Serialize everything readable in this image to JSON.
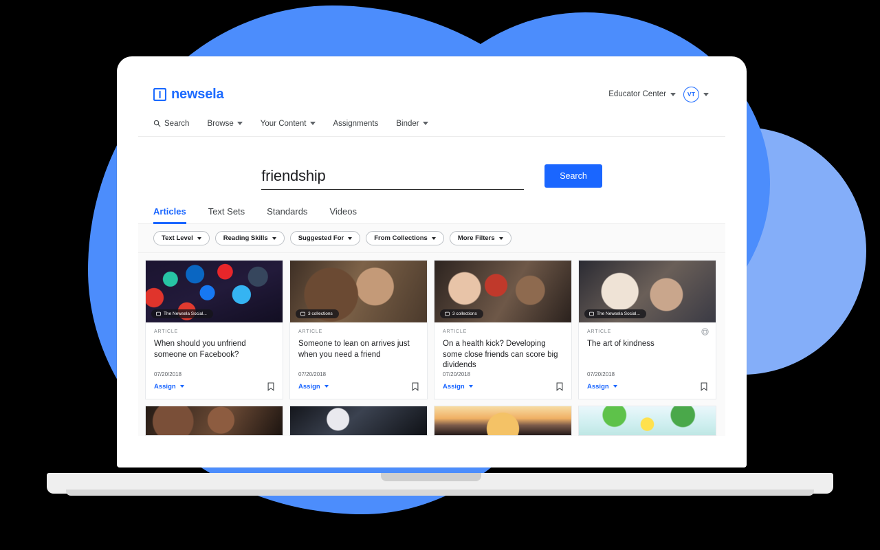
{
  "brand": {
    "name": "newsela",
    "logo_icon": "newsela-book-logo",
    "color": "#1d6bff"
  },
  "topbar": {
    "educator_center": "Educator Center",
    "educator_caret_icon": "chevron-down-icon",
    "avatar_initials": "VT",
    "avatar_caret_icon": "chevron-down-icon"
  },
  "nav": {
    "items": [
      {
        "label": "Search",
        "icon": "search-icon",
        "has_caret": false
      },
      {
        "label": "Browse",
        "icon": "",
        "has_caret": true
      },
      {
        "label": "Your Content",
        "icon": "",
        "has_caret": true
      },
      {
        "label": "Assignments",
        "icon": "",
        "has_caret": false
      },
      {
        "label": "Binder",
        "icon": "",
        "has_caret": true
      }
    ]
  },
  "search": {
    "value": "friendship",
    "placeholder": "Search",
    "button_label": "Search",
    "button_color": "#1a66ff"
  },
  "tabs": [
    {
      "label": "Articles",
      "active": true
    },
    {
      "label": "Text Sets",
      "active": false
    },
    {
      "label": "Standards",
      "active": false
    },
    {
      "label": "Videos",
      "active": false
    }
  ],
  "filters": [
    {
      "label": "Text Level"
    },
    {
      "label": "Reading Skills"
    },
    {
      "label": "Suggested For"
    },
    {
      "label": "From Collections"
    },
    {
      "label": "More Filters"
    }
  ],
  "cards": [
    {
      "kicker": "ARTICLE",
      "title": "When should you unfriend someone on Facebook?",
      "date": "07/20/2018",
      "assign_label": "Assign",
      "badge": "The Newsela Social...",
      "badge_icon": "collection-icon",
      "corner_icon": "",
      "bookmark_icon": "bookmark-icon",
      "photo": "ph1"
    },
    {
      "kicker": "ARTICLE",
      "title": "Someone to lean on arrives just when you need a friend",
      "date": "07/20/2018",
      "assign_label": "Assign",
      "badge": "3 collections",
      "badge_icon": "collection-icon",
      "corner_icon": "",
      "bookmark_icon": "bookmark-icon",
      "photo": "ph2"
    },
    {
      "kicker": "ARTICLE",
      "title": "On a health kick? Developing some close friends can score big dividends",
      "date": "07/20/2018",
      "assign_label": "Assign",
      "badge": "3 collections",
      "badge_icon": "collection-icon",
      "corner_icon": "",
      "bookmark_icon": "bookmark-icon",
      "photo": "ph3"
    },
    {
      "kicker": "ARTICLE",
      "title": "The art of kindness",
      "date": "07/20/2018",
      "assign_label": "Assign",
      "badge": "The Newsela Social...",
      "badge_icon": "collection-icon",
      "corner_icon": "collection-badge-icon",
      "bookmark_icon": "bookmark-icon",
      "photo": "ph4"
    }
  ],
  "cards_row2": [
    {
      "photo": "ph5"
    },
    {
      "photo": "ph6"
    },
    {
      "photo": "ph7"
    },
    {
      "photo": "ph8"
    }
  ],
  "decor": {
    "blob_primary_color": "#4c8dfc",
    "blob_secondary_color": "#84aef9",
    "background_color": "#000000"
  }
}
